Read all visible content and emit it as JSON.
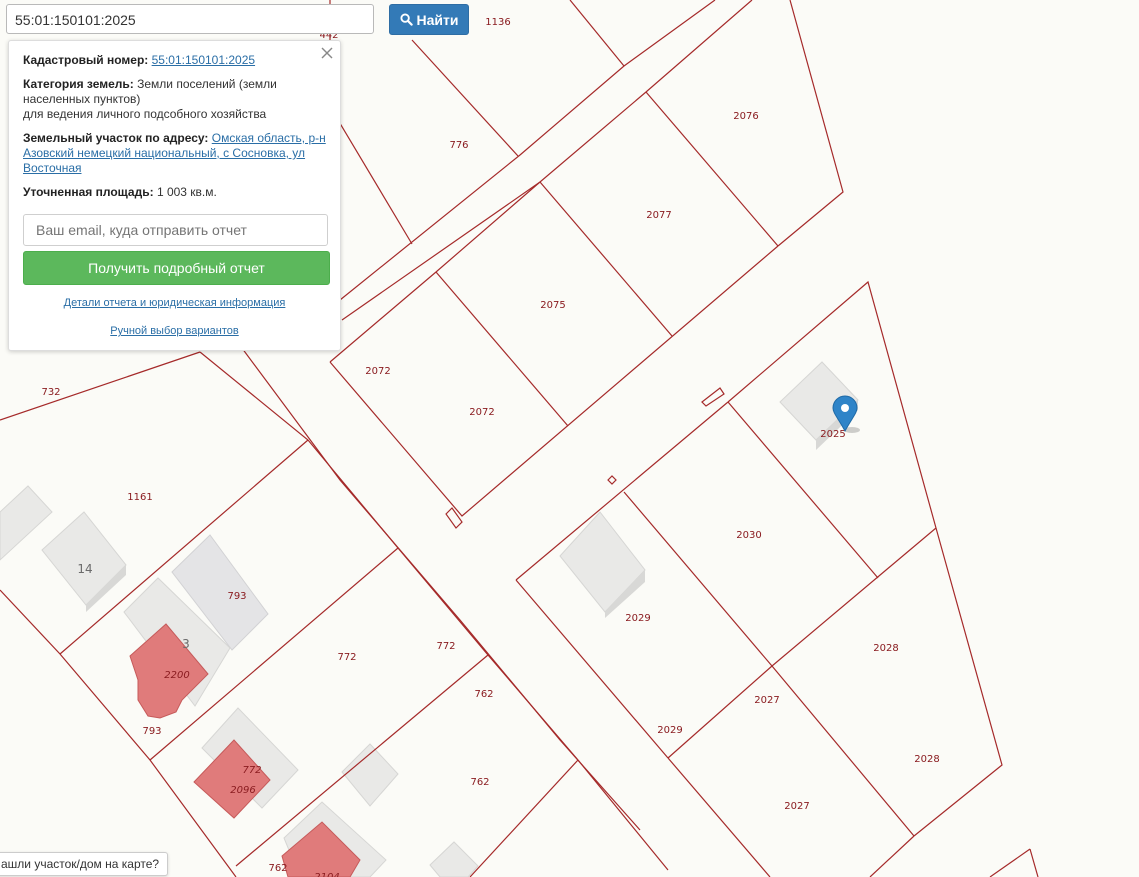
{
  "search": {
    "value": "55:01:150101:2025",
    "button_label": "Найти"
  },
  "info_panel": {
    "cadastral_label": "Кадастровый номер:",
    "cadastral_value": "55:01:150101:2025",
    "category_label": "Категория земель:",
    "category_value": "Земли поселений (земли населенных пунктов)",
    "category_value2": "для ведения личного подсобного хозяйства",
    "address_label": "Земельный участок по адресу:",
    "address_value": "Омская область, р-н Азовский немецкий национальный, с Сосновка, ул Восточная",
    "area_label": "Уточненная площадь:",
    "area_value": "1 003 кв.м.",
    "email_placeholder": "Ваш email, куда отправить отчет",
    "report_button": "Получить подробный отчет",
    "details_link": "Детали отчета и юридическая информация",
    "manual_link": "Ручной выбор вариантов"
  },
  "bottom_tip": "ашли участок/дом на карте?",
  "plot_labels": [
    "1136",
    "442",
    "776",
    "2076",
    "2077",
    "2075",
    "2072",
    "2072",
    "732",
    "1161",
    "2025",
    "793",
    "14",
    "3",
    "2200",
    "2030",
    "2029",
    "2028",
    "772",
    "772",
    "762",
    "793",
    "772",
    "2096",
    "2027",
    "2029",
    "2027",
    "2028",
    "762",
    "762",
    "2104"
  ],
  "colors": {
    "boundary": "#a52a2a",
    "highlight": "#e07b7b",
    "building": "#e9e9e7",
    "accent": "#337ab7",
    "green": "#5cb85c"
  }
}
